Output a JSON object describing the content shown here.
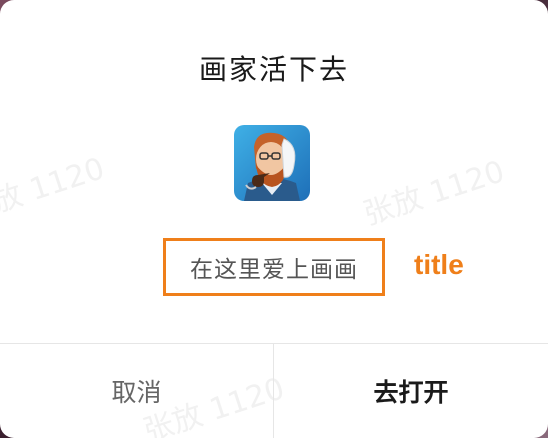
{
  "dialog": {
    "title": "画家活下去",
    "subtitle": "在这里爱上画画",
    "annotation_label": "title",
    "cancel_label": "取消",
    "open_label": "去打开",
    "watermark": "张放 1120",
    "app_icon": "van-gogh-portrait-icon"
  },
  "colors": {
    "annotation": "#ef7f1a",
    "title": "#1a1a1a",
    "cancel_text": "#666666"
  }
}
